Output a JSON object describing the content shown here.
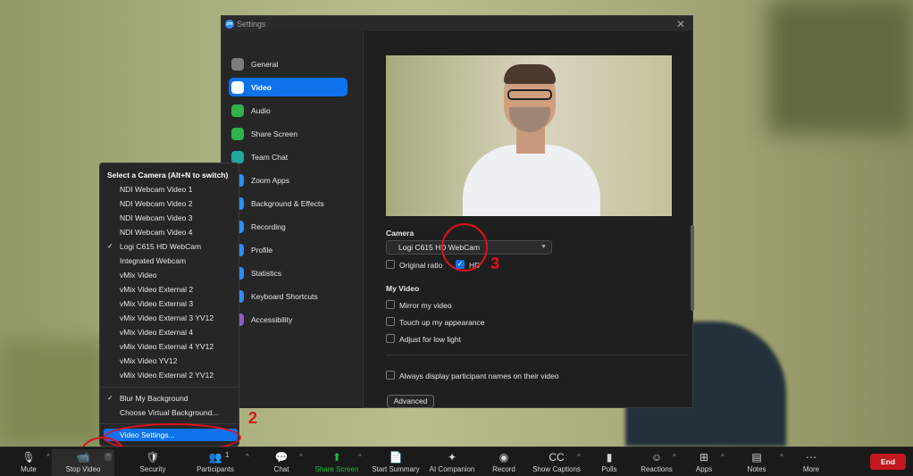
{
  "settings": {
    "title": "Settings",
    "app_badge": "zm",
    "close_glyph": "✕",
    "nav": [
      {
        "label": "General",
        "icon": "gear-icon",
        "color": "#7d7d7d",
        "active": false
      },
      {
        "label": "Video",
        "icon": "video-camera-icon",
        "color": "#0e72ed",
        "active": true
      },
      {
        "label": "Audio",
        "icon": "headphones-icon",
        "color": "#2fb34a",
        "active": false
      },
      {
        "label": "Share Screen",
        "icon": "share-screen-icon",
        "color": "#2fb34a",
        "active": false
      },
      {
        "label": "Team Chat",
        "icon": "chat-icon",
        "color": "#20a6a0",
        "active": false
      },
      {
        "label": "Zoom Apps",
        "icon": "apps-icon",
        "color": "#2d8cff",
        "active": false
      },
      {
        "label": "Background & Effects",
        "icon": "background-icon",
        "color": "#2d8cff",
        "active": false
      },
      {
        "label": "Recording",
        "icon": "recording-icon",
        "color": "#2d8cff",
        "active": false
      },
      {
        "label": "Profile",
        "icon": "profile-icon",
        "color": "#2d8cff",
        "active": false
      },
      {
        "label": "Statistics",
        "icon": "statistics-icon",
        "color": "#2d8cff",
        "active": false
      },
      {
        "label": "Keyboard Shortcuts",
        "icon": "keyboard-icon",
        "color": "#2d8cff",
        "active": false
      },
      {
        "label": "Accessibility",
        "icon": "accessibility-icon",
        "color": "#8e5cc7",
        "active": false
      }
    ],
    "video": {
      "camera_heading": "Camera",
      "camera_selected": "Logi C615 HD WebCam",
      "original_ratio": "Original ratio",
      "hd": "HD",
      "my_video_heading": "My Video",
      "mirror": "Mirror my video",
      "touch_up": "Touch up my appearance",
      "low_light": "Adjust for low light",
      "always_display": "Always display participant names on their video",
      "advanced": "Advanced"
    }
  },
  "camera_menu": {
    "title": "Select a Camera (Alt+N to switch)",
    "cameras": [
      {
        "label": "NDI Webcam Video 1",
        "checked": false
      },
      {
        "label": "NDI Webcam Video 2",
        "checked": false
      },
      {
        "label": "NDI Webcam Video 3",
        "checked": false
      },
      {
        "label": "NDI Webcam Video 4",
        "checked": false
      },
      {
        "label": "Logi C615 HD WebCam",
        "checked": true
      },
      {
        "label": "Integrated Webcam",
        "checked": false
      },
      {
        "label": "vMix Video",
        "checked": false
      },
      {
        "label": "vMix Video External 2",
        "checked": false
      },
      {
        "label": "vMix Video External 3",
        "checked": false
      },
      {
        "label": "vMix Video External 3 YV12",
        "checked": false
      },
      {
        "label": "vMix Video External 4",
        "checked": false
      },
      {
        "label": "vMix Video External 4 YV12",
        "checked": false
      },
      {
        "label": "vMix Video YV12",
        "checked": false
      },
      {
        "label": "vMix Video External 2 YV12",
        "checked": false
      }
    ],
    "blur": "Blur My Background",
    "choose_bg": "Choose Virtual Background...",
    "video_settings": "Video Settings..."
  },
  "annotations": {
    "n2": "2",
    "n3": "3"
  },
  "toolbar": {
    "items": [
      {
        "label": "Mute",
        "icon": "microphone-icon",
        "glyph": "🎙"
      },
      {
        "label": "Stop Video",
        "icon": "video-camera-icon",
        "glyph": "📹"
      },
      {
        "label": "Security",
        "icon": "shield-icon",
        "glyph": "🛡"
      },
      {
        "label": "Participants",
        "icon": "participants-icon",
        "glyph": "👥",
        "count": "1"
      },
      {
        "label": "Chat",
        "icon": "chat-icon",
        "glyph": "💬"
      },
      {
        "label": "Share Screen",
        "icon": "share-screen-icon",
        "glyph": "⬆"
      },
      {
        "label": "Start Summary",
        "icon": "summary-icon",
        "glyph": "📄"
      },
      {
        "label": "AI Companion",
        "icon": "sparkle-icon",
        "glyph": "✦"
      },
      {
        "label": "Record",
        "icon": "record-icon",
        "glyph": "◉"
      },
      {
        "label": "Show Captions",
        "icon": "captions-icon",
        "glyph": "CC"
      },
      {
        "label": "Polls",
        "icon": "polls-icon",
        "glyph": "▮"
      },
      {
        "label": "Reactions",
        "icon": "reactions-icon",
        "glyph": "☺"
      },
      {
        "label": "Apps",
        "icon": "apps-icon",
        "glyph": "⊞"
      },
      {
        "label": "Notes",
        "icon": "notes-icon",
        "glyph": "▤"
      },
      {
        "label": "More",
        "icon": "more-icon",
        "glyph": "⋯"
      }
    ],
    "end": "End",
    "share_color": "#19c23a"
  }
}
